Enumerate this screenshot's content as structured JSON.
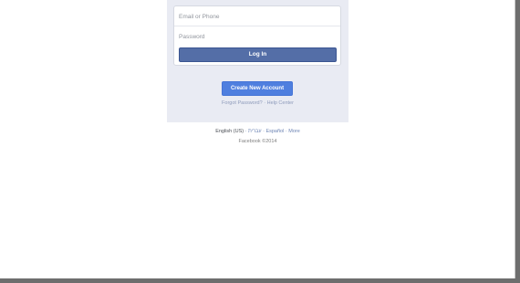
{
  "login": {
    "email_placeholder": "Email or Phone",
    "password_placeholder": "Password",
    "login_label": "Log In"
  },
  "signup": {
    "create_label": "Create New Account"
  },
  "help": {
    "forgot_label": "Forgot Password?",
    "separator": "·",
    "help_center_label": "Help Center"
  },
  "footer": {
    "languages": [
      "English (US)",
      "עברית",
      "Español",
      "More"
    ],
    "language_separator": "·",
    "copyright": "Facebook ©2014"
  },
  "colors": {
    "panel_background": "#e9ebf3",
    "login_button": "#546ea7",
    "create_button": "#4f7fdf",
    "link": "#6d84b4"
  }
}
